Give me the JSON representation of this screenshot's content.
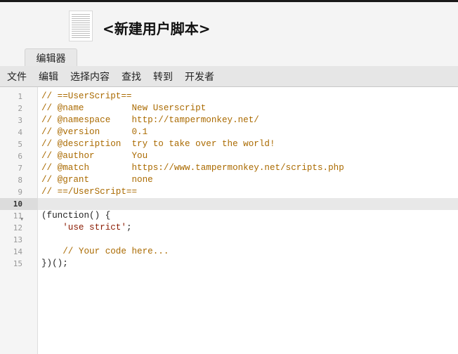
{
  "header": {
    "title": "<新建用户脚本>",
    "tab_label": "编辑器"
  },
  "menu": [
    "文件",
    "编辑",
    "选择内容",
    "查找",
    "转到",
    "开发者"
  ],
  "editor": {
    "active_line": 10,
    "folded_line": 11,
    "lines": [
      "// ==UserScript==",
      "// @name         New Userscript",
      "// @namespace    http://tampermonkey.net/",
      "// @version      0.1",
      "// @description  try to take over the world!",
      "// @author       You",
      "// @match        https://www.tampermonkey.net/scripts.php",
      "// @grant        none",
      "// ==/UserScript==",
      "",
      "(function() {",
      "    'use strict';",
      "",
      "    // Your code here...",
      "})();"
    ]
  },
  "colors": {
    "comment": "#aa6a00",
    "string": "#8a1a00",
    "text": "#222222"
  }
}
